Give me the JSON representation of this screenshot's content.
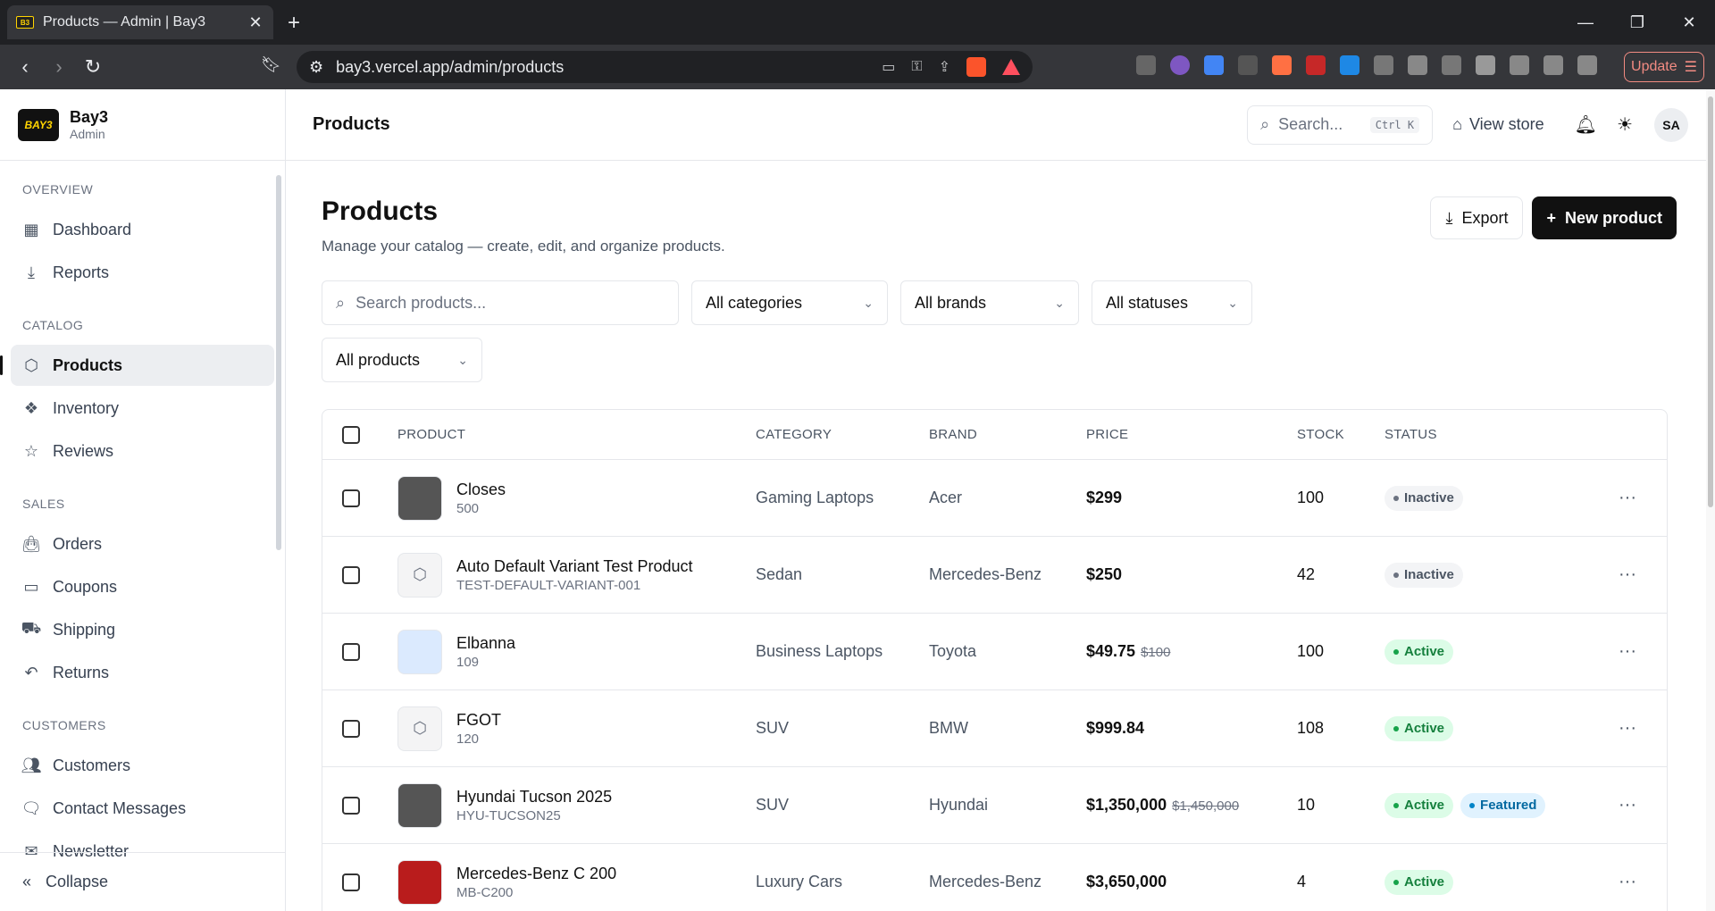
{
  "browser": {
    "tab_title": "Products — Admin | Bay3",
    "url": "bay3.vercel.app/admin/products",
    "update_label": "Update"
  },
  "sidebar": {
    "brand_name": "Bay3",
    "brand_sub": "Admin",
    "logo_text": "BAY3",
    "sections": [
      {
        "title": "OVERVIEW",
        "items": [
          {
            "label": "Dashboard",
            "icon": "grid-icon"
          },
          {
            "label": "Reports",
            "icon": "download-icon"
          }
        ]
      },
      {
        "title": "CATALOG",
        "items": [
          {
            "label": "Products",
            "icon": "package-icon"
          },
          {
            "label": "Inventory",
            "icon": "boxes-icon"
          },
          {
            "label": "Reviews",
            "icon": "star-icon"
          }
        ]
      },
      {
        "title": "SALES",
        "items": [
          {
            "label": "Orders",
            "icon": "bag-icon"
          },
          {
            "label": "Coupons",
            "icon": "ticket-icon"
          },
          {
            "label": "Shipping",
            "icon": "truck-icon"
          },
          {
            "label": "Returns",
            "icon": "undo-icon"
          }
        ]
      },
      {
        "title": "CUSTOMERS",
        "items": [
          {
            "label": "Customers",
            "icon": "users-icon"
          },
          {
            "label": "Contact Messages",
            "icon": "message-icon"
          },
          {
            "label": "Newsletter",
            "icon": "mail-icon"
          }
        ]
      }
    ],
    "collapse_label": "Collapse"
  },
  "topbar": {
    "title": "Products",
    "search_placeholder": "Search...",
    "search_shortcut": "Ctrl K",
    "view_store": "View store",
    "avatar": "SA"
  },
  "page": {
    "title": "Products",
    "subtitle": "Manage your catalog — create, edit, and organize products.",
    "export_label": "Export",
    "new_label": "New product"
  },
  "filters": {
    "search_placeholder": "Search products...",
    "category": "All categories",
    "brand": "All brands",
    "status": "All statuses",
    "scope": "All products"
  },
  "table": {
    "headers": {
      "product": "PRODUCT",
      "category": "CATEGORY",
      "brand": "BRAND",
      "price": "PRICE",
      "stock": "STOCK",
      "status": "STATUS"
    },
    "rows": [
      {
        "name": "Closes",
        "sku": "500",
        "category": "Gaming Laptops",
        "brand": "Acer",
        "price": "$299",
        "old_price": "",
        "stock": "100",
        "status": "Inactive",
        "featured": "",
        "thumb": "dark"
      },
      {
        "name": "Auto Default Variant Test Product",
        "sku": "TEST-DEFAULT-VARIANT-001",
        "category": "Sedan",
        "brand": "Mercedes-Benz",
        "price": "$250",
        "old_price": "",
        "stock": "42",
        "status": "Inactive",
        "featured": "",
        "thumb": "placeholder"
      },
      {
        "name": "Elbanna",
        "sku": "109",
        "category": "Business Laptops",
        "brand": "Toyota",
        "price": "$49.75",
        "old_price": "$100",
        "stock": "100",
        "status": "Active",
        "featured": "",
        "thumb": "light"
      },
      {
        "name": "FGOT",
        "sku": "120",
        "category": "SUV",
        "brand": "BMW",
        "price": "$999.84",
        "old_price": "",
        "stock": "108",
        "status": "Active",
        "featured": "",
        "thumb": "placeholder"
      },
      {
        "name": "Hyundai Tucson 2025",
        "sku": "HYU-TUCSON25",
        "category": "SUV",
        "brand": "Hyundai",
        "price": "$1,350,000",
        "old_price": "$1,450,000",
        "stock": "10",
        "status": "Active",
        "featured": "Featured",
        "thumb": "dark"
      },
      {
        "name": "Mercedes-Benz C 200",
        "sku": "MB-C200",
        "category": "Luxury Cars",
        "brand": "Mercedes-Benz",
        "price": "$3,650,000",
        "old_price": "",
        "stock": "4",
        "status": "Active",
        "featured": "",
        "thumb": "red"
      }
    ]
  }
}
